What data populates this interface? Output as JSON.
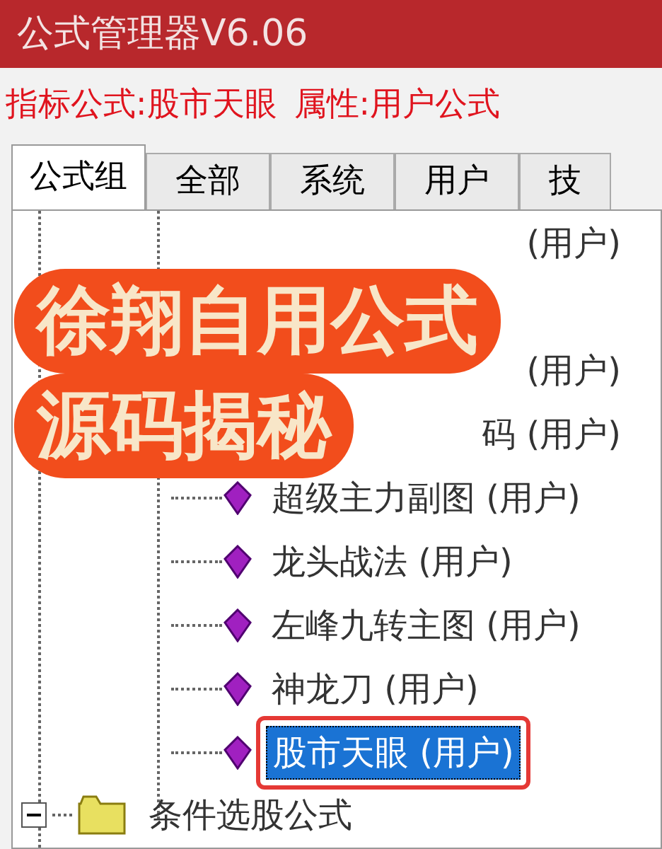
{
  "window": {
    "title": "公式管理器V6.06"
  },
  "info": {
    "formula_label": "指标公式:",
    "formula_value": "股市天眼",
    "attr_label": "属性:",
    "attr_value": "用户公式"
  },
  "tabs": [
    {
      "label": "公式组",
      "selected": true
    },
    {
      "label": "全部",
      "selected": false
    },
    {
      "label": "系统",
      "selected": false
    },
    {
      "label": "用户",
      "selected": false
    },
    {
      "label": "技",
      "selected": false
    }
  ],
  "tree": {
    "items": [
      {
        "kind": "partial",
        "text": "(用户)"
      },
      {
        "kind": "hidden"
      },
      {
        "kind": "partial",
        "text": "(用户)"
      },
      {
        "kind": "partial",
        "text": "码 (用户)"
      },
      {
        "kind": "formula",
        "text": "超级主力副图 (用户)",
        "selected": false
      },
      {
        "kind": "formula",
        "text": "龙头战法 (用户)",
        "selected": false
      },
      {
        "kind": "formula",
        "text": "左峰九转主图 (用户)",
        "selected": false
      },
      {
        "kind": "formula",
        "text": "神龙刀 (用户)",
        "selected": false
      },
      {
        "kind": "formula",
        "text": "股市天眼 (用户)",
        "selected": true
      }
    ],
    "folder": {
      "text": "条件选股公式",
      "expanded": true
    }
  },
  "banner": {
    "lines": [
      "徐翔自用公式",
      "源码揭秘"
    ]
  }
}
